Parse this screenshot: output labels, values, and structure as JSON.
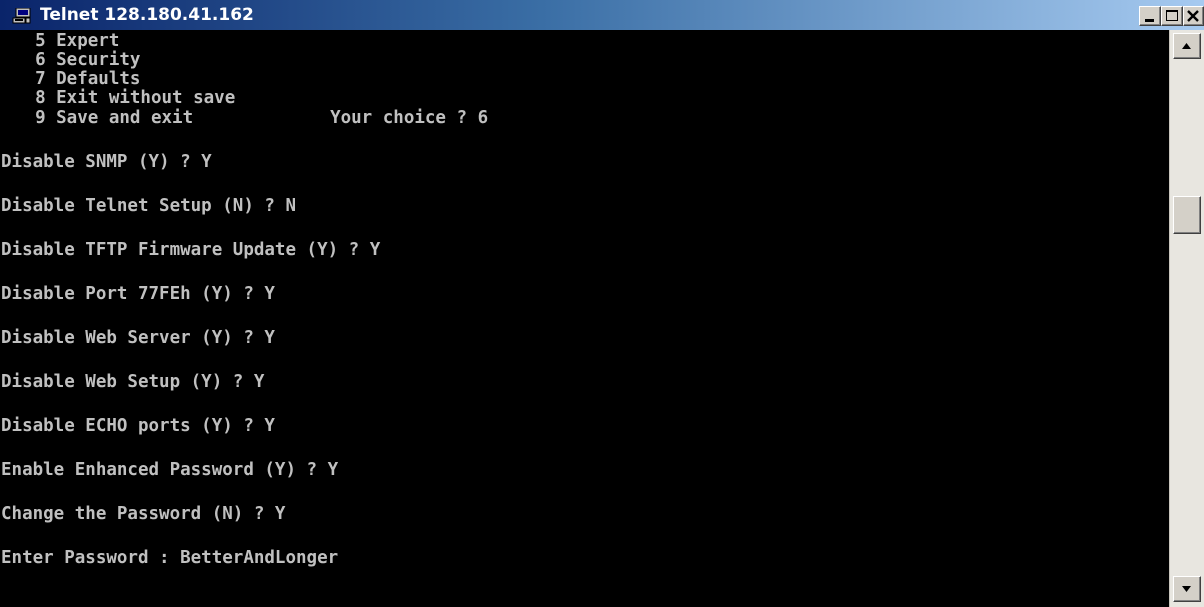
{
  "window": {
    "title": "Telnet 128.180.41.162",
    "icon": "telnet-computer-icon",
    "controls": [
      "minimize-icon",
      "maximize-icon",
      "close-icon"
    ]
  },
  "terminal": {
    "lines": [
      "  5 Expert",
      "  6 Security",
      "  7 Defaults",
      "  8 Exit without save",
      "  9 Save and exit             Your choice ? 6",
      "Disable SNMP (Y) ? Y",
      "Disable Telnet Setup (N) ? N",
      "Disable TFTP Firmware Update (Y) ? Y",
      "Disable Port 77FEh (Y) ? Y",
      "Disable Web Server (Y) ? Y",
      "Disable Web Setup (Y) ? Y",
      "Disable ECHO ports (Y) ? Y",
      "Enable Enhanced Password (Y) ? Y",
      "Change the Password (N) ? Y",
      "Enter Password : BetterAndLonger"
    ]
  },
  "scrollbar": {
    "up_icon": "scroll-up-arrow-icon",
    "down_icon": "scroll-down-arrow-icon"
  },
  "colors": {
    "terminal_background": "#000000",
    "terminal_text": "#c0c0c0",
    "titlebar_start": "#0a246a",
    "titlebar_end": "#a6caf0",
    "chrome": "#d4d0c8"
  }
}
